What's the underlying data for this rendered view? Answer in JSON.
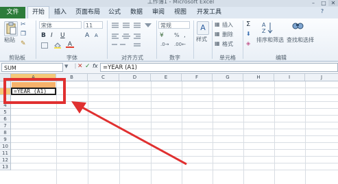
{
  "window": {
    "title": "工作簿1 - Microsoft Excel",
    "min": "–",
    "max": "□",
    "close": "✕"
  },
  "tabs": {
    "file": "文件",
    "items": [
      "开始",
      "插入",
      "页面布局",
      "公式",
      "数据",
      "审阅",
      "视图",
      "开发工具"
    ],
    "help": "?"
  },
  "ribbon": {
    "paste": "粘贴",
    "clipboard_group": "剪贴板",
    "font_name": "宋体",
    "font_size": "11",
    "font_group": "字体",
    "bold": "B",
    "italic": "I",
    "underline": "U",
    "font_grow": "A",
    "font_shrink": "A",
    "align_group": "对齐方式",
    "number_format": "常规",
    "number_group": "数字",
    "percent": "%",
    "comma": ",",
    "styles": "样式",
    "insert": "插入",
    "delete": "删除",
    "format": "格式",
    "cells_group": "单元格",
    "sigma": "Σ",
    "sort_filter": "排序和筛选",
    "find_select": "查找和选择",
    "edit_group": "编辑"
  },
  "formula_bar": {
    "name_box": "SUM",
    "cancel": "✕",
    "enter": "✓",
    "fx": "fx",
    "formula": "=YEAR (A1)"
  },
  "columns": [
    "A",
    "B",
    "C",
    "D",
    "E",
    "F",
    "G",
    "H",
    "I",
    "J"
  ],
  "rows": [
    "1",
    "2",
    "3",
    "4",
    "5",
    "6",
    "7",
    "8",
    "9",
    "10",
    "11",
    "12",
    "13"
  ],
  "cells": {
    "A1": "",
    "A2": "=YEAR (A1)"
  },
  "annotation": {
    "color": "#e03030"
  }
}
